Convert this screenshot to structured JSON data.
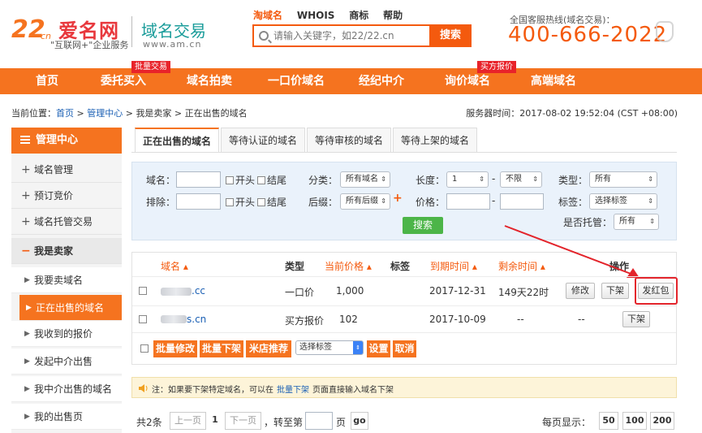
{
  "header": {
    "logo_number": "22",
    "logo_cn": "cn",
    "logo_name": "爱名网",
    "logo_slogan": "\"互联网+\"企业服务",
    "brand_title": "域名交易",
    "brand_url": "www.am.cn",
    "top_links": [
      "淘域名",
      "WHOIS",
      "商标",
      "帮助"
    ],
    "search_placeholder": "请输入关键字，如22/22.cn",
    "search_button": "搜索",
    "hotline_label": "全国客服热线(域名交易)：",
    "hotline_number": "400-666-2022"
  },
  "mainnav": {
    "items": [
      "首页",
      "委托买入",
      "域名拍卖",
      "一口价域名",
      "经纪中介",
      "询价域名",
      "高端域名"
    ],
    "badge_1": "批量交易",
    "badge_5": "买方报价"
  },
  "breadcrumb": {
    "prefix": "当前位置：",
    "home": "首页",
    "sep": " > ",
    "admin": "管理中心",
    "seller": "我是卖家",
    "current": "正在出售的域名"
  },
  "server_time": "服务器时间：2017-08-02 19:52:04 (CST +08:00)",
  "sidebar": {
    "title": "管理中心",
    "items": [
      {
        "pm": "+",
        "label": "域名管理"
      },
      {
        "pm": "+",
        "label": "预订竞价"
      },
      {
        "pm": "+",
        "label": "域名托管交易"
      },
      {
        "pm": "−",
        "label": "我是卖家"
      }
    ],
    "subitems": [
      "我要卖域名",
      "正在出售的域名",
      "我收到的报价",
      "发起中介出售",
      "我中介出售的域名",
      "我的出售页"
    ]
  },
  "tabs": [
    "正在出售的域名",
    "等待认证的域名",
    "等待审核的域名",
    "等待上架的域名"
  ],
  "filter": {
    "domain_label": "域名：",
    "exclude_label": "排除：",
    "head": "开头",
    "tail": "结尾",
    "category_label": "分类：",
    "category_value": "所有域名",
    "suffix_label": "后缀：",
    "suffix_value": "所有后缀",
    "length_label": "长度：",
    "length_min": "1",
    "length_max": "不限",
    "price_label": "价格：",
    "dash": "-",
    "type_label": "类型：",
    "type_value": "所有",
    "tag_label": "标签：",
    "tag_value": "选择标签",
    "hosted_label": "是否托管：",
    "hosted_value": "所有",
    "search": "搜索"
  },
  "table": {
    "headers": {
      "domain": "域名 ▴",
      "type": "类型",
      "price": "当前价格 ▴",
      "tag": "标签",
      "expiry": "到期时间 ▴",
      "remaining": "剩余时间 ▴",
      "action": "操作"
    },
    "rows": [
      {
        "domain_suffix": ".cc",
        "type": "一口价",
        "price": "1,000",
        "expiry": "2017-12-31",
        "remaining": "149天22时",
        "b1": "修改",
        "b2": "下架",
        "b3": "发红包"
      },
      {
        "domain_suffix": "s.cn",
        "type": "买方报价",
        "price": "102",
        "expiry": "2017-10-09",
        "remaining": "--",
        "remaining2": "--",
        "b2": "下架"
      }
    ],
    "bulk": {
      "edit": "批量修改",
      "offline": "批量下架",
      "recommend": "米店推荐",
      "tag_select": "选择标签",
      "set": "设置",
      "cancel": "取消"
    }
  },
  "note": {
    "prefix": "注：如果要下架特定域名，可以在",
    "link": "批量下架",
    "suffix": "页面直接输入域名下架"
  },
  "pagination": {
    "total": "共2条",
    "prev": "上一页",
    "page": "1",
    "next": "下一页",
    "goto_prefix": "，转至第",
    "goto_suffix": "页",
    "go": "go",
    "per_page_label": "每页显示：",
    "sizes": [
      "50",
      "100",
      "200"
    ]
  },
  "colors": {
    "brand_orange": "#f5731f",
    "highlight_red": "#e3242b",
    "link_blue": "#1a5fb4",
    "green_button": "#4cb548"
  }
}
